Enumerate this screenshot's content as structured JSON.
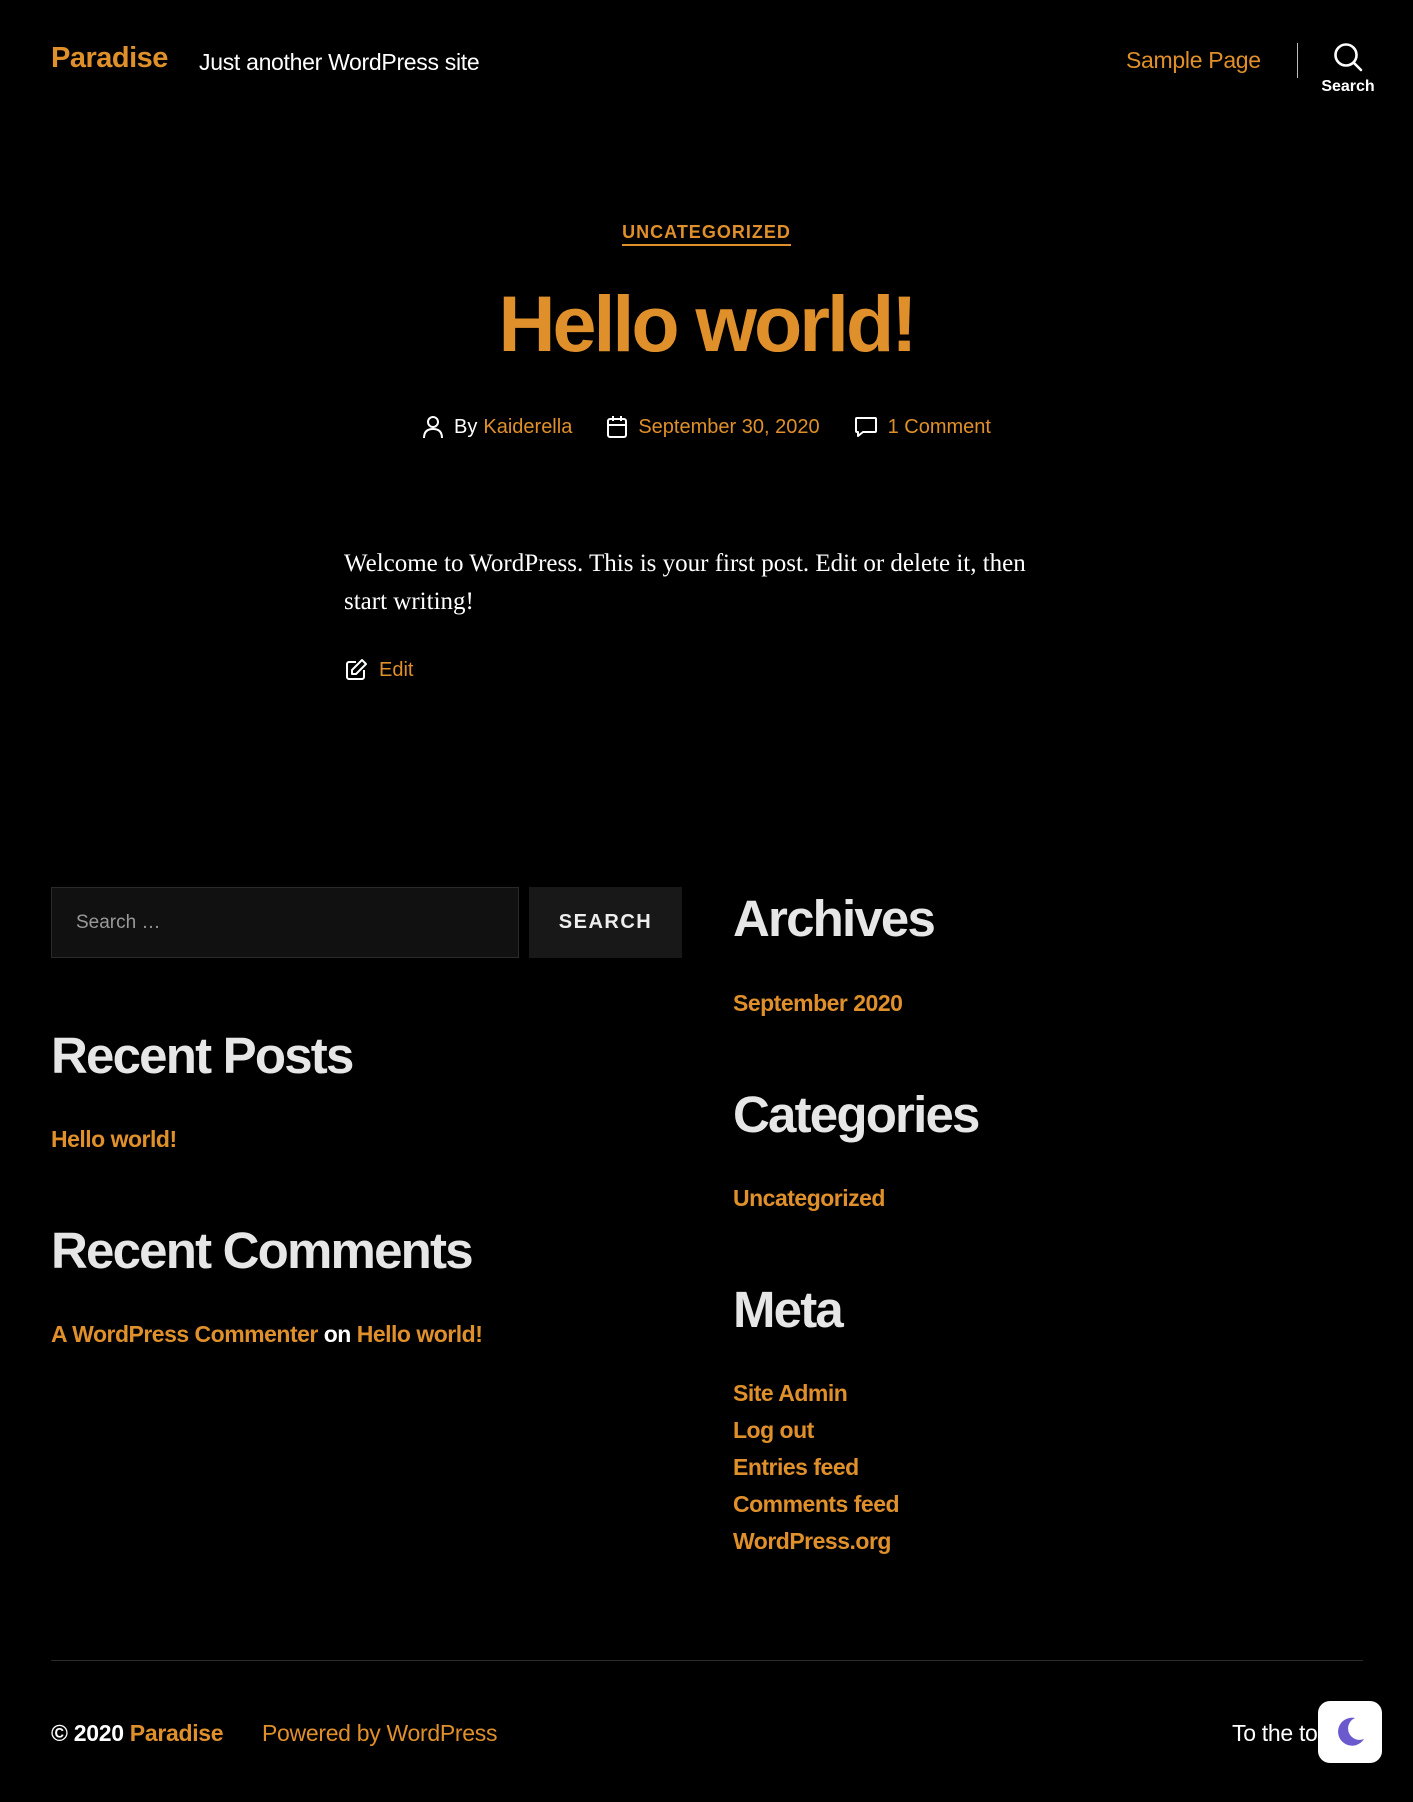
{
  "header": {
    "site_title": "Paradise",
    "site_description": "Just another WordPress site",
    "nav": [
      {
        "label": "Sample Page"
      }
    ],
    "search_label": "Search"
  },
  "post": {
    "category": "UNCATEGORIZED",
    "title": "Hello world!",
    "by_label": "By",
    "author": "Kaiderella",
    "date": "September 30, 2020",
    "comments": "1 Comment",
    "content": "Welcome to WordPress. This is your first post. Edit or delete it, then start writing!",
    "edit_label": "Edit"
  },
  "widgets": {
    "search": {
      "placeholder": "Search …",
      "button_label": "SEARCH"
    },
    "recent_posts": {
      "title": "Recent Posts",
      "items": [
        "Hello world!"
      ]
    },
    "recent_comments": {
      "title": "Recent Comments",
      "items": [
        {
          "author": "A WordPress Commenter",
          "on": "on",
          "post": "Hello world!"
        }
      ]
    },
    "archives": {
      "title": "Archives",
      "items": [
        "September 2020"
      ]
    },
    "categories": {
      "title": "Categories",
      "items": [
        "Uncategorized"
      ]
    },
    "meta": {
      "title": "Meta",
      "items": [
        "Site Admin",
        "Log out",
        "Entries feed",
        "Comments feed",
        "WordPress.org"
      ]
    }
  },
  "footer": {
    "copyright": "© 2020",
    "site_link": "Paradise",
    "powered_by": "Powered by WordPress",
    "to_top": "To the top"
  },
  "colors": {
    "accent": "#e0902a",
    "background": "#000000",
    "toggle_moon": "#6a5acd"
  },
  "icons": {
    "search_toggle": "search-icon",
    "author": "user-icon",
    "date": "calendar-icon",
    "comments": "comment-icon",
    "edit": "edit-icon",
    "dark_mode": "moon-icon"
  }
}
